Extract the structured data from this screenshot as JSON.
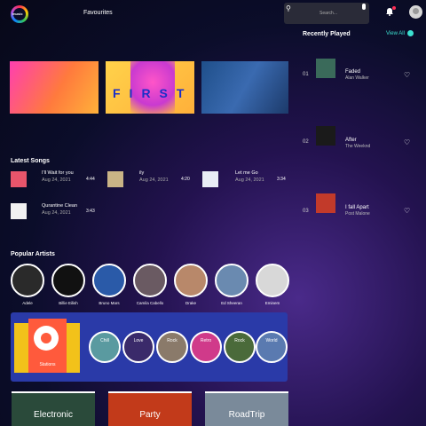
{
  "header": {
    "logo_text": "music",
    "nav_label": "Favourites",
    "search_placeholder": "Search..."
  },
  "banners": [
    {
      "name": "banner-1"
    },
    {
      "name": "banner-2",
      "text": "FIRST"
    },
    {
      "name": "banner-3"
    }
  ],
  "latest_songs": {
    "title": "Latest Songs",
    "items": [
      {
        "title": "I'll Wait for you",
        "date": "Aug 24, 2021",
        "duration": "4:44",
        "color": "#e8556b"
      },
      {
        "title": "ily",
        "date": "Aug 24, 2021",
        "duration": "4:20",
        "color": "#c9b486"
      },
      {
        "title": "Let me Go",
        "date": "Aug 24, 2021",
        "duration": "3:34",
        "color": "#e9eef5"
      },
      {
        "title": "Qurantine Clean",
        "date": "Aug 24, 2021",
        "duration": "3:43",
        "color": "#f2f2f2"
      }
    ]
  },
  "popular_artists": {
    "title": "Popular Artists",
    "items": [
      {
        "name": "Adele",
        "color": "#2a2a2a"
      },
      {
        "name": "Billie Eilish",
        "color": "#111111"
      },
      {
        "name": "Bruno Mars",
        "color": "#2a5aa8"
      },
      {
        "name": "Camila Cabello",
        "color": "#6a5a62"
      },
      {
        "name": "Drake",
        "color": "#b8886a"
      },
      {
        "name": "Ed Sheeran",
        "color": "#6a8ab0"
      },
      {
        "name": "Eminem",
        "color": "#d8d8d8"
      }
    ]
  },
  "stations": {
    "label": "Stations",
    "genres": [
      {
        "label": "Chill",
        "color": "#5a9aa0"
      },
      {
        "label": "Love",
        "color": "#3a2a6a"
      },
      {
        "label": "Rock",
        "color": "#8a7a6a"
      },
      {
        "label": "Retro",
        "color": "#d03a8a"
      },
      {
        "label": "Rock",
        "color": "#4a6a3a"
      },
      {
        "label": "World",
        "color": "#5a7ab0"
      }
    ]
  },
  "playlists": [
    {
      "label": "Electronic",
      "color": "#2a4a3a"
    },
    {
      "label": "Party",
      "color": "#c23a1a"
    },
    {
      "label": "RoadTrip",
      "color": "#7a8a9a"
    }
  ],
  "recently_played": {
    "title": "Recently Played",
    "view_all": "View All",
    "items": [
      {
        "num": "01",
        "title": "Faded",
        "artist": "Alan Walker",
        "color": "#3a6a5a"
      },
      {
        "num": "02",
        "title": "After",
        "artist": "The Weeknd",
        "color": "#1a1a1a"
      },
      {
        "num": "03",
        "title": "I fall Apart",
        "artist": "Post Malone",
        "color": "#c23a2a"
      }
    ]
  }
}
